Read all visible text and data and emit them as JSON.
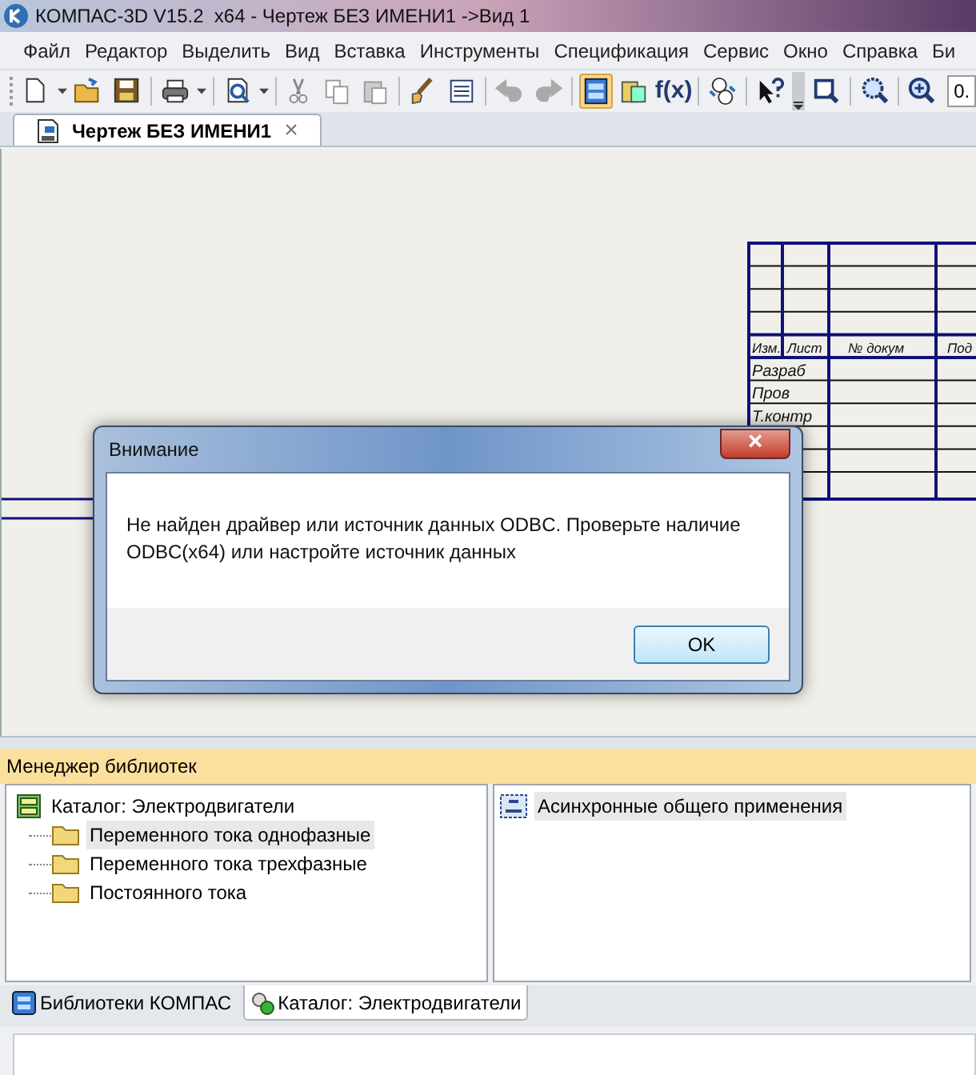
{
  "window": {
    "title": "КОМПАС-3D V15.2  x64 - Чертеж БЕЗ ИМЕНИ1 ->Вид 1"
  },
  "menu": [
    "Файл",
    "Редактор",
    "Выделить",
    "Вид",
    "Вставка",
    "Инструменты",
    "Спецификация",
    "Сервис",
    "Окно",
    "Справка",
    "Би"
  ],
  "toolbar": [
    {
      "kind": "new",
      "dropdown": true
    },
    {
      "kind": "open"
    },
    {
      "kind": "save"
    },
    {
      "kind": "sep"
    },
    {
      "kind": "print",
      "dropdown": true
    },
    {
      "kind": "sep"
    },
    {
      "kind": "preview",
      "dropdown": true
    },
    {
      "kind": "sep"
    },
    {
      "kind": "cut"
    },
    {
      "kind": "copy"
    },
    {
      "kind": "paste"
    },
    {
      "kind": "sep"
    },
    {
      "kind": "brush"
    },
    {
      "kind": "list"
    },
    {
      "kind": "sep"
    },
    {
      "kind": "undo"
    },
    {
      "kind": "redo"
    },
    {
      "kind": "sep"
    },
    {
      "kind": "panel",
      "selected": true
    },
    {
      "kind": "vars",
      "selected": false
    },
    {
      "kind": "text",
      "label": "f(x)",
      "selected": false
    },
    {
      "kind": "sep"
    },
    {
      "kind": "numbers"
    },
    {
      "kind": "sep"
    },
    {
      "kind": "help"
    },
    {
      "kind": "grip"
    },
    {
      "kind": "zoomwin"
    },
    {
      "kind": "sep"
    },
    {
      "kind": "zoomall"
    },
    {
      "kind": "sep"
    },
    {
      "kind": "zoomin"
    },
    {
      "kind": "field",
      "value": "0."
    }
  ],
  "document_tabs": [
    {
      "label": "Чертеж БЕЗ ИМЕНИ1",
      "close": "×",
      "selected": true
    }
  ],
  "title_block": {
    "headers": [
      "Изм.",
      "Лист",
      "№ докум",
      "Под"
    ],
    "rows": [
      "Разраб",
      "Пров",
      "Т.контр"
    ]
  },
  "dialog": {
    "title": "Внимание",
    "close": "×",
    "message": "Не найден драйвер или источник данных ODBC. Проверьте наличие ODBC(x64) или настройте источник данных",
    "buttons": [
      "OK"
    ]
  },
  "library_manager": {
    "title": "Менеджер библиотек",
    "tree": [
      {
        "label": "Каталог: Электродвигатели",
        "selected": false,
        "children": [
          {
            "label": "Переменного тока однофазные",
            "selected": true
          },
          {
            "label": "Переменного тока трехфазные",
            "selected": false
          },
          {
            "label": "Постоянного тока",
            "selected": false
          }
        ]
      }
    ],
    "items": [
      {
        "label": "Асинхронные общего применения",
        "selected": true
      }
    ],
    "tabs": [
      {
        "label": "Библиотеки КОМПАС",
        "selected": false
      },
      {
        "label": "Каталог: Электродвигатели",
        "selected": true
      }
    ]
  }
}
